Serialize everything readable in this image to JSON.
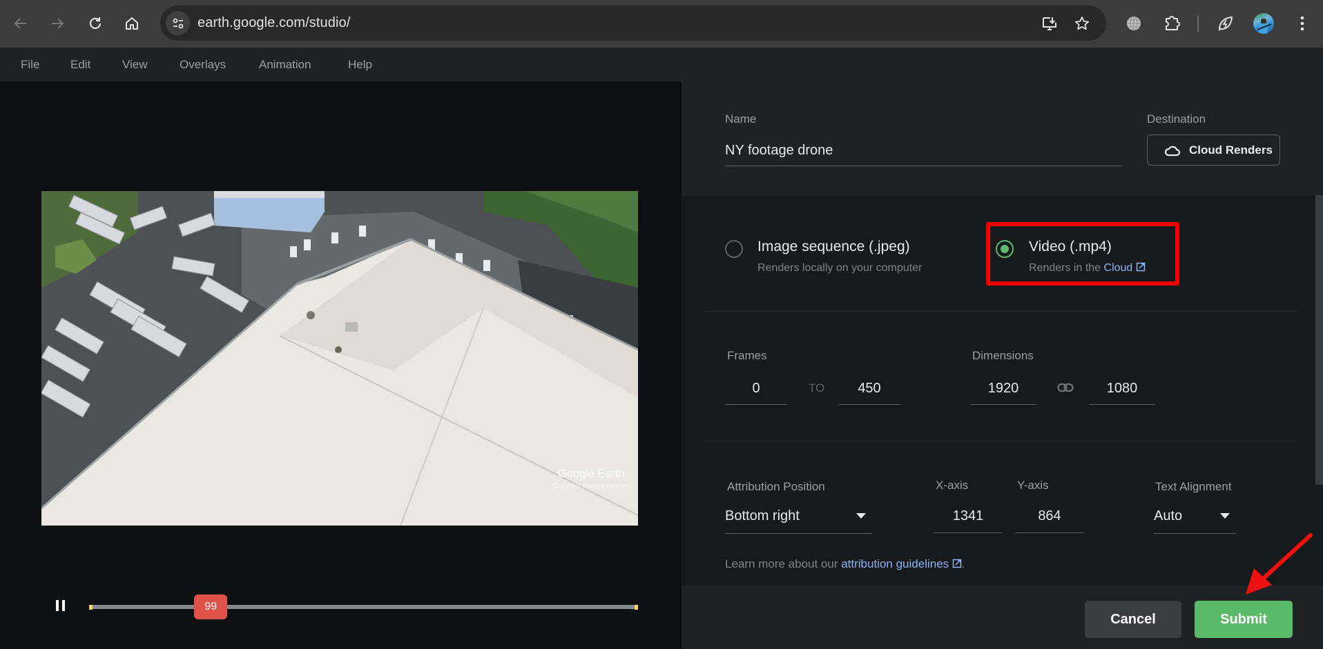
{
  "browser": {
    "url": "earth.google.com/studio/",
    "icons": [
      "back-icon",
      "forward-icon",
      "reload-icon",
      "home-icon",
      "site-info-icon",
      "install-app-icon",
      "bookmark-star-icon",
      "globe-extension-icon",
      "extensions-puzzle-icon",
      "energy-saver-icon",
      "profile-avatar",
      "more-menu-icon"
    ]
  },
  "menu": {
    "items": [
      "File",
      "Edit",
      "View",
      "Overlays",
      "Animation",
      "Help"
    ]
  },
  "preview": {
    "watermark_logo": "Google Earth",
    "watermark_copyright": "[Copyright imagery sources]",
    "current_frame": "99",
    "frame_start": 0,
    "frame_end": 450,
    "progress_fraction": 0.22,
    "playback_state": "playing"
  },
  "render": {
    "name_label": "Name",
    "name_value": "NY footage drone",
    "destination_label": "Destination",
    "destination_button": "Cloud Renders",
    "options": [
      {
        "title": "Image sequence (.jpeg)",
        "subtitle": "Renders locally on your computer",
        "selected": false
      },
      {
        "title": "Video (.mp4)",
        "subtitle_prefix": "Renders in the ",
        "subtitle_link": "Cloud",
        "selected": true
      }
    ],
    "frames_label": "Frames",
    "frame_from": "0",
    "frame_to_label": "TO",
    "frame_to": "450",
    "dimensions_label": "Dimensions",
    "width": "1920",
    "height": "1080",
    "attribution_position_label": "Attribution Position",
    "attribution_position_value": "Bottom right",
    "x_axis_label": "X-axis",
    "x_axis_value": "1341",
    "y_axis_label": "Y-axis",
    "y_axis_value": "864",
    "text_alignment_label": "Text Alignment",
    "text_alignment_value": "Auto",
    "learn_more_prefix": "Learn more about our ",
    "learn_more_link": "attribution guidelines",
    "learn_more_suffix": "."
  },
  "footer": {
    "cancel_label": "Cancel",
    "submit_label": "Submit"
  },
  "colors": {
    "accent_green": "#5bb96a",
    "link_blue": "#8ab4f8",
    "timeline_handle": "#e0534a",
    "annotation_red": "#ee0000"
  }
}
